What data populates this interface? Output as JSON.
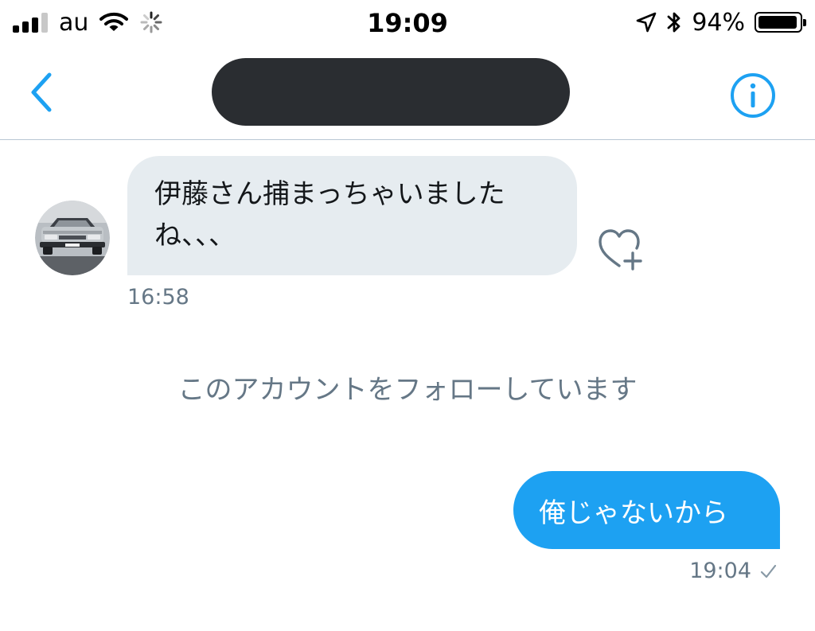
{
  "status_bar": {
    "carrier": "au",
    "time": "19:09",
    "battery_percent": "94%",
    "signal_bars_active": 3,
    "icons": [
      "signal-icon",
      "wifi-icon",
      "activity-spinner-icon",
      "location-arrow-icon",
      "bluetooth-icon",
      "battery-icon"
    ]
  },
  "nav": {
    "back_icon": "chevron-left-icon",
    "info_icon": "info-circle-icon",
    "title_redacted": true
  },
  "colors": {
    "accent": "#1da1f2",
    "incoming_bubble": "#e6ecf0",
    "secondary_text": "#657786",
    "redaction": "#2a2d31"
  },
  "messages": {
    "incoming": {
      "text": "伊藤さん捕まっちゃいましたね、、、",
      "time": "16:58",
      "like_icon": "heart-plus-icon"
    },
    "system_note": "このアカウントをフォローしています",
    "outgoing": {
      "text": "俺じゃないから",
      "time": "19:04",
      "status_icon": "checkmark-icon"
    }
  }
}
